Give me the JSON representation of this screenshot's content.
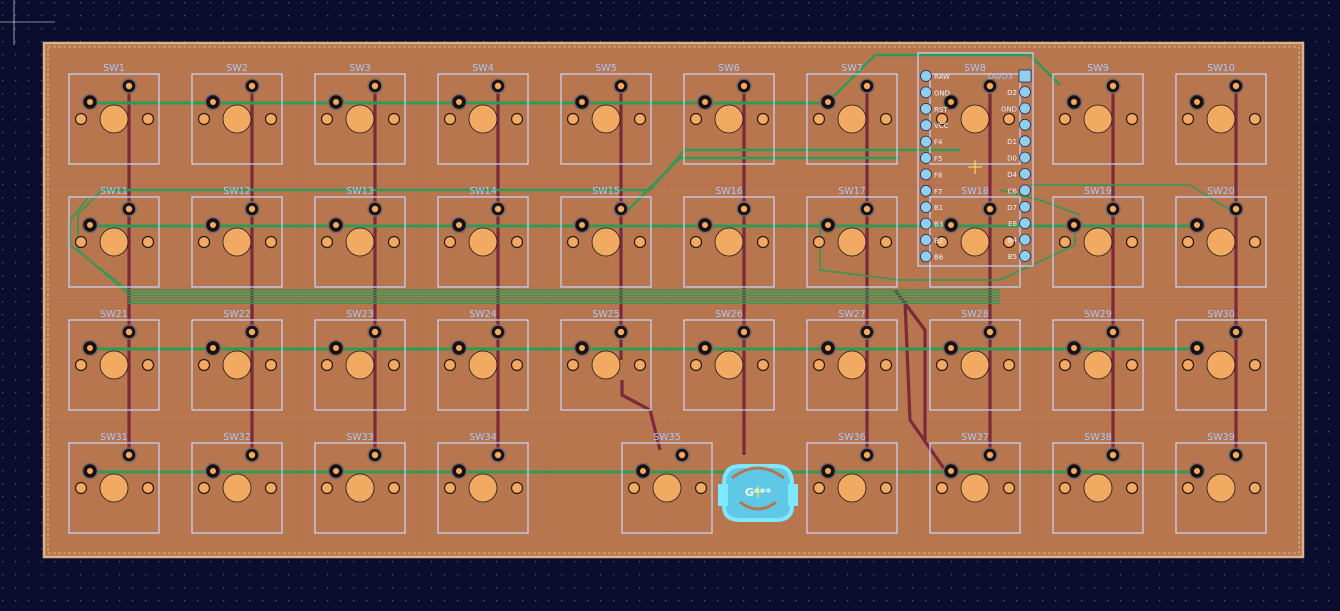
{
  "app": {
    "title": "",
    "colors": {
      "background": "#0b0d2e",
      "grid_dot": "#4b5b7a",
      "board_fill": "#b8764e",
      "board_edge": "#d9b48a",
      "copper_back_track": "#7a2a3a",
      "copper_front_track": "#2f9a55",
      "pad": "#f2aa62",
      "silkscreen": "#a8c8ff",
      "courtyard": "#c8d8ff",
      "logo": "#7de8ff",
      "via": "#e6d45a"
    }
  },
  "switches": {
    "row1": [
      "SW1",
      "SW2",
      "SW3",
      "SW4",
      "SW5",
      "SW6",
      "SW7",
      "SW8",
      "SW9",
      "SW10"
    ],
    "row2": [
      "SW11",
      "SW12",
      "SW13",
      "SW14",
      "SW15",
      "SW16",
      "SW17",
      "SW18",
      "SW19",
      "SW20"
    ],
    "row3": [
      "SW21",
      "SW22",
      "SW23",
      "SW24",
      "SW25",
      "SW26",
      "SW27",
      "SW28",
      "SW29",
      "SW30"
    ],
    "row4": [
      "SW31",
      "SW32",
      "SW33",
      "SW34",
      "SW35",
      "SW36",
      "SW37",
      "SW38",
      "SW39"
    ]
  },
  "mcu": {
    "label": "D0/D3",
    "left_pins": [
      "RAW",
      "GND",
      "RST",
      "VCC",
      "F4",
      "F5",
      "F6",
      "F7",
      "B1",
      "B3",
      "B2",
      "B6"
    ],
    "right_pins": [
      "D2",
      "GND",
      "",
      "D1",
      "D0",
      "D4",
      "C6",
      "D7",
      "E6",
      "B4",
      "B5"
    ]
  },
  "logo": {
    "label": "G***",
    "icon": "logo-icon"
  }
}
